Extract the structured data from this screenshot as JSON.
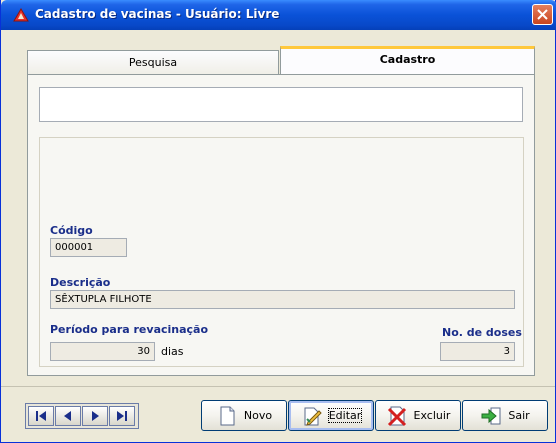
{
  "window": {
    "title": "Cadastro de vacinas - Usuário: Livre"
  },
  "tabs": [
    {
      "label": "Pesquisa",
      "active": false
    },
    {
      "label": "Cadastro",
      "active": true
    }
  ],
  "form": {
    "codigo_label": "Código",
    "codigo_value": "000001",
    "descricao_label": "Descrição",
    "descricao_value": "SÊXTUPLA FILHOTE",
    "periodo_label": "Período para revacinação",
    "periodo_value": "30",
    "periodo_unit": "dias",
    "doses_label": "No. de doses",
    "doses_value": "3"
  },
  "navigation": {
    "icons": [
      "first-record-icon",
      "previous-record-icon",
      "next-record-icon",
      "last-record-icon"
    ]
  },
  "buttons": {
    "novo": "Novo",
    "editar": "Editar",
    "excluir": "Excluir",
    "sair": "Sair"
  },
  "colors": {
    "titlebar": "#0A52D8",
    "label": "#1A2E8A",
    "active_tab_accent": "#FFC83C"
  }
}
